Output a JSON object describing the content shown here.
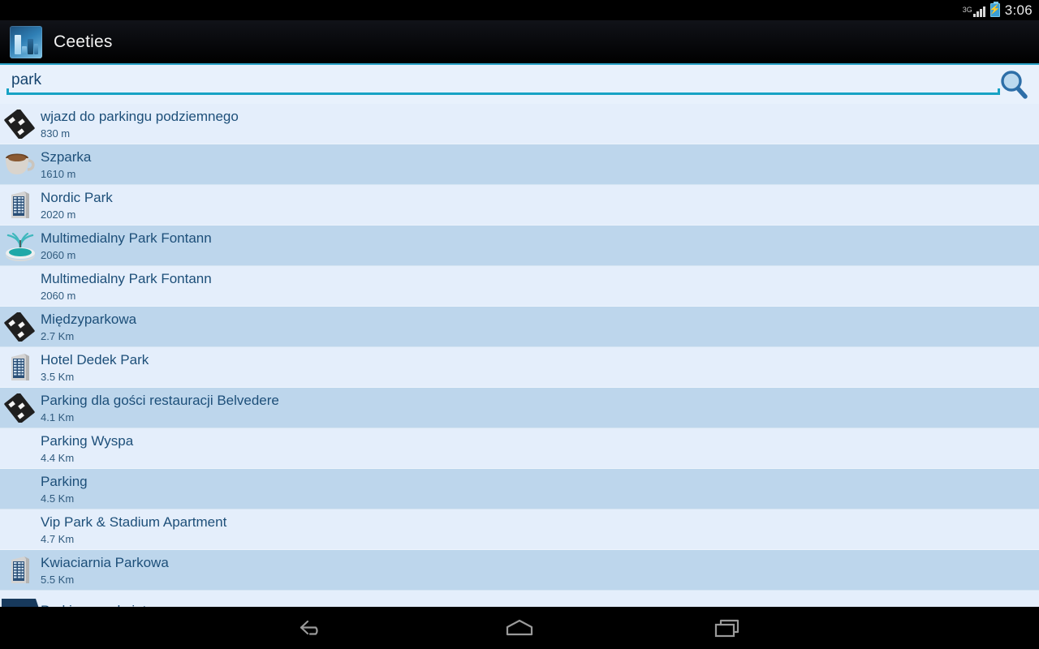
{
  "statusbar": {
    "network_label": "3G",
    "battery_icon": "battery-charging-icon",
    "signal_icon": "signal-3g-icon",
    "clock": "3:06"
  },
  "actionbar": {
    "app_icon": "ceeties-app-icon",
    "title": "Ceeties",
    "accent_color": "#2aa3c8"
  },
  "search": {
    "value": "park",
    "placeholder": "park",
    "icon": "search-icon",
    "underline_color": "#17a2c4"
  },
  "list": {
    "row_color_odd": "#e4eefb",
    "row_color_even": "#bdd6ec",
    "items": [
      {
        "title": "wjazd do parkingu podziemnego",
        "distance": "830 m",
        "icon": "road-icon"
      },
      {
        "title": "Szparka",
        "distance": "1610 m",
        "icon": "cup-icon"
      },
      {
        "title": "Nordic Park",
        "distance": "2020 m",
        "icon": "building-icon"
      },
      {
        "title": "Multimedialny Park Fontann",
        "distance": "2060 m",
        "icon": "fountain-icon"
      },
      {
        "title": "Multimedialny Park Fontann",
        "distance": "2060 m",
        "icon": "none"
      },
      {
        "title": "Międzyparkowa",
        "distance": "2.7 Km",
        "icon": "road-icon"
      },
      {
        "title": "Hotel Dedek Park",
        "distance": "3.5 Km",
        "icon": "building-icon"
      },
      {
        "title": "Parking dla gości restauracji Belvedere",
        "distance": "4.1 Km",
        "icon": "road-icon"
      },
      {
        "title": "Parking Wyspa",
        "distance": "4.4 Km",
        "icon": "none"
      },
      {
        "title": "Parking",
        "distance": "4.5 Km",
        "icon": "none"
      },
      {
        "title": "Vip Park & Stadium Apartment",
        "distance": "4.7 Km",
        "icon": "none"
      },
      {
        "title": "Kwiaciarnia Parkowa",
        "distance": "5.5 Km",
        "icon": "building-icon"
      },
      {
        "title": "Parking zamknięty",
        "distance": "",
        "icon": "gate-icon"
      }
    ]
  },
  "navbar": {
    "back_label": "back-button",
    "home_label": "home-button",
    "recents_label": "recents-button"
  }
}
